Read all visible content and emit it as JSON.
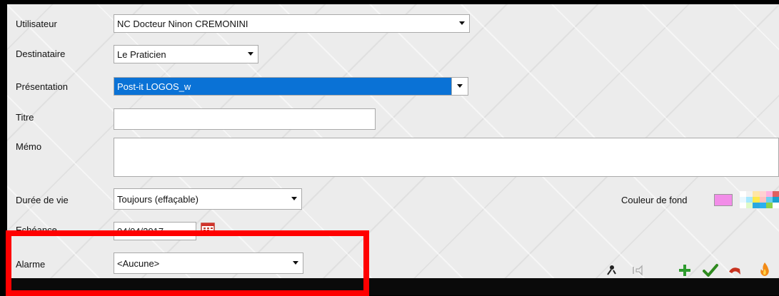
{
  "form": {
    "utilisateur": {
      "label": "Utilisateur",
      "value": "NC Docteur Ninon CREMONINI"
    },
    "destinataire": {
      "label": "Destinataire",
      "value": "Le Praticien"
    },
    "presentation": {
      "label": "Présentation",
      "value": "Post-it LOGOS_w"
    },
    "titre": {
      "label": "Titre",
      "value": ""
    },
    "memo": {
      "label": "Mémo",
      "value": ""
    },
    "duree": {
      "label": "Durée de vie",
      "value": "Toujours (effaçable)"
    },
    "echeance": {
      "label": "Echéance",
      "value": "04/04/2017"
    },
    "alarme": {
      "label": "Alarme",
      "value": "<Aucune>"
    }
  },
  "couleur_de_fond": {
    "label": "Couleur de fond",
    "swatch": "#f28de8"
  },
  "toolbar_icons": [
    "pin-icon",
    "speaker-icon",
    "add-icon",
    "validate-icon",
    "undo-icon",
    "fire-icon"
  ],
  "colors": {
    "highlight": "#0a72d6",
    "annotation": "#ff0000"
  }
}
